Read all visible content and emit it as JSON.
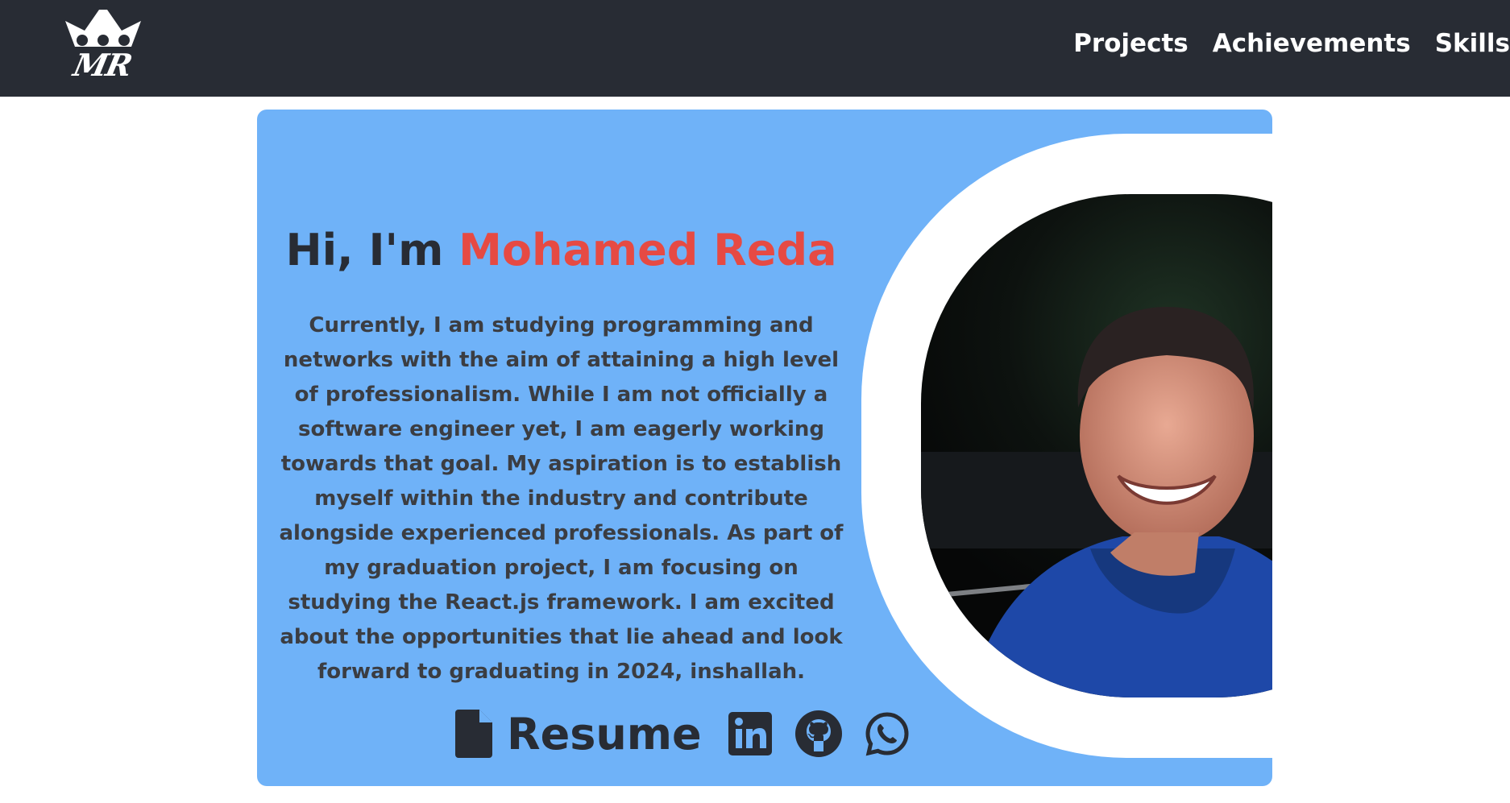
{
  "nav": {
    "logo_text": "MR",
    "links": [
      "Projects",
      "Achievements",
      "Skills"
    ]
  },
  "hero": {
    "greeting": "Hi, I'm",
    "name": "Mohamed Reda",
    "bio": "Currently, I am studying programming and networks with the aim of attaining a high level of professionalism. While I am not officially a software engineer yet, I am eagerly working towards that goal. My aspiration is to establish myself within the industry and contribute alongside experienced professionals. As part of my graduation project, I am focusing on studying the React.js framework. I am excited about the opportunities that lie ahead and look forward to graduating in 2024, inshallah.",
    "resume_label": "Resume",
    "social_icons": [
      "linkedin-icon",
      "github-icon",
      "whatsapp-icon"
    ]
  },
  "colors": {
    "navbar": "#282c34",
    "hero_background": "#6fb2f8",
    "name_accent": "#e64a43",
    "text_dark": "#282c34"
  }
}
